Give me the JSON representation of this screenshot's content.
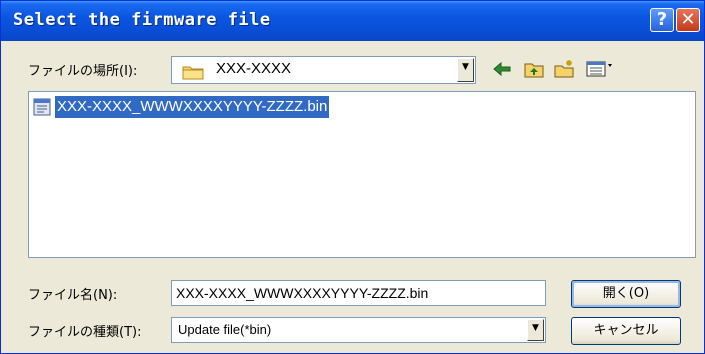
{
  "window": {
    "title": "Select the firmware file",
    "help_glyph": "?",
    "close_glyph": "✕"
  },
  "look_in": {
    "label": "ファイルの場所(I):",
    "value": "XXX-XXXX",
    "icon": "folder-icon"
  },
  "toolbar": {
    "icons": [
      "back-icon",
      "up-folder-icon",
      "new-folder-icon",
      "view-menu-icon"
    ]
  },
  "file_list": {
    "items": [
      {
        "name": "XXX-XXXX_WWWXXXXYYYY-ZZZZ.bin",
        "selected": true,
        "icon": "bin-file-icon"
      }
    ]
  },
  "file_name": {
    "label": "ファイル名(N):",
    "value": "XXX-XXXX_WWWXXXXYYYY-ZZZZ.bin"
  },
  "file_type": {
    "label": "ファイルの種類(T):",
    "value": "Update file(*bin)"
  },
  "buttons": {
    "open": "開く(O)",
    "cancel": "キャンセル"
  },
  "colors": {
    "titlebar": "#0a56e0",
    "selection": "#316ac5",
    "dialog_bg": "#ece9d8"
  }
}
